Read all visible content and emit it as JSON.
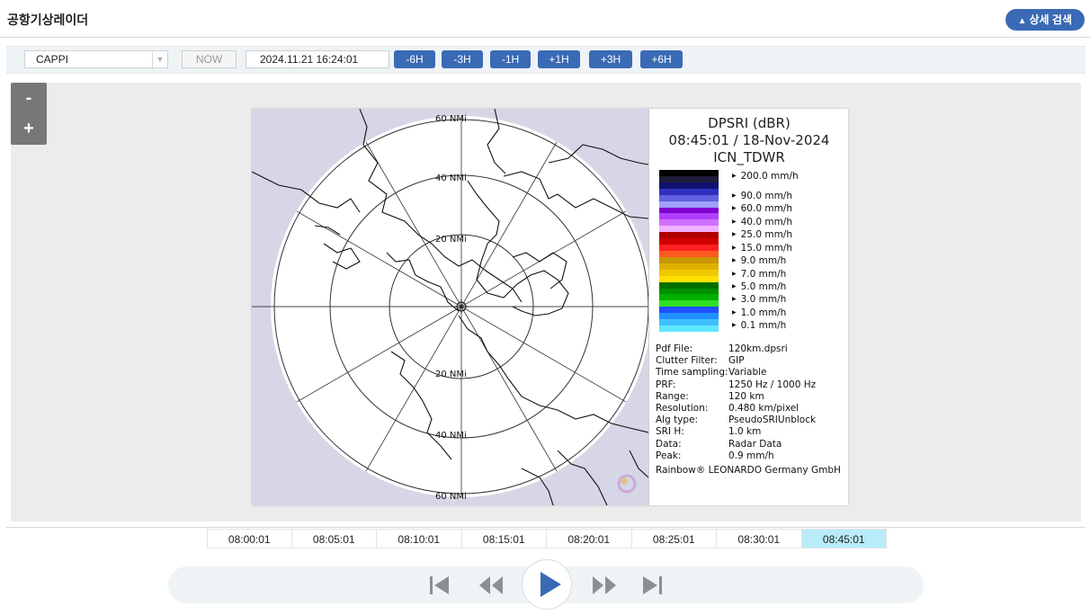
{
  "header": {
    "title": "공항기상레이더",
    "detail_search": "상세 검색"
  },
  "toolbar": {
    "product_select": "CAPPI",
    "now_label": "NOW",
    "datetime_value": "2024.11.21  16:24:01",
    "steps": [
      "-6H",
      "-3H",
      "-1H",
      "+1H",
      "+3H",
      "+6H"
    ]
  },
  "zoom": {
    "out": "-",
    "in": "+"
  },
  "radar": {
    "title": "DPSRI (dBR)",
    "timestamp": "08:45:01 / 18-Nov-2024",
    "site": "ICN_TDWR",
    "range_labels": [
      "60 NMi",
      "40 NMi",
      "20 NMi",
      "20 NMi",
      "40 NMi",
      "60 NMi"
    ],
    "scale_labels": [
      "200.0 mm/h",
      "90.0 mm/h",
      "60.0 mm/h",
      "40.0 mm/h",
      "25.0 mm/h",
      "15.0 mm/h",
      "9.0 mm/h",
      "7.0 mm/h",
      "5.0 mm/h",
      "3.0 mm/h",
      "1.0 mm/h",
      "0.1 mm/h"
    ],
    "scale_colors": [
      "#000000",
      "#1c1c3a",
      "#101070",
      "#3030c0",
      "#6060e0",
      "#a0a0ff",
      "#8000d0",
      "#b040ff",
      "#d070ff",
      "#f0b0ff",
      "#b00000",
      "#d00000",
      "#ff2020",
      "#ff5a1e",
      "#c89600",
      "#e0b000",
      "#f0c800",
      "#ffe000",
      "#007000",
      "#009000",
      "#00b000",
      "#30e020",
      "#2050ff",
      "#2090ff",
      "#40c0ff",
      "#60e8ff"
    ],
    "info": [
      {
        "k": "Pdf File:",
        "v": "120km.dpsri"
      },
      {
        "k": "Clutter Filter:",
        "v": "GIP"
      },
      {
        "k": "Time sampling:",
        "v": "Variable"
      },
      {
        "k": "PRF:",
        "v": "1250 Hz / 1000 Hz"
      },
      {
        "k": "Range:",
        "v": "120 km"
      },
      {
        "k": "Resolution:",
        "v": "0.480 km/pixel"
      },
      {
        "k": "Alg type:",
        "v": "PseudoSRIUnblock"
      },
      {
        "k": "SRI H:",
        "v": "1.0 km"
      },
      {
        "k": "Data:",
        "v": "Radar Data"
      },
      {
        "k": "Peak:",
        "v": "0.9 mm/h"
      }
    ],
    "credit": "Rainbow® LEONARDO Germany GmbH"
  },
  "timeline": {
    "times": [
      "08:00:01",
      "08:05:01",
      "08:10:01",
      "08:15:01",
      "08:20:01",
      "08:25:01",
      "08:30:01",
      "08:45:01"
    ],
    "active_index": 7
  },
  "player": {
    "icons": [
      "skip-start-icon",
      "rewind-icon",
      "play-icon",
      "fast-forward-icon",
      "skip-end-icon"
    ]
  },
  "colors": {
    "accent": "#3a6ab5",
    "active_time": "#b8ecf8",
    "toolbar_bg": "#eef3f6",
    "map_bg": "#ececec"
  }
}
